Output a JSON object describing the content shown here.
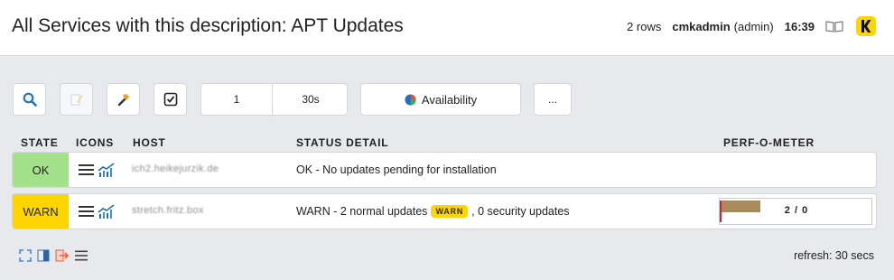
{
  "header": {
    "title": "All Services with this description: APT Updates",
    "rows": "2 rows",
    "user": "cmkadmin",
    "role": "(admin)",
    "time": "16:39",
    "logo_letter": "K"
  },
  "toolbar": {
    "search_icon": "magnifier-icon",
    "edit_icon": "edit-pencil-icon",
    "commands_icon": "hammer-icon",
    "checkbox_icon": "checkbox-icon",
    "refresh_count": "1",
    "refresh_interval": "30s",
    "availability_label": "Availability",
    "more_label": "..."
  },
  "table": {
    "columns": {
      "state": "STATE",
      "icons": "ICONS",
      "host": "HOST",
      "status_detail": "STATUS DETAIL",
      "perf": "PERF-O-METER"
    },
    "rows": [
      {
        "state": "OK",
        "state_color": "#a3e28b",
        "host": "ich2.heikejurzik.de",
        "detail": "OK - No updates pending for installation"
      },
      {
        "state": "WARN",
        "state_color": "#ffd500",
        "host": "stretch.fritz.box",
        "detail_before": "WARN - 2 normal updates",
        "detail_badge": "WARN",
        "detail_after": ", 0 security updates",
        "perf_value": "2 / 0",
        "perf_fill_fraction": 0.27
      }
    ]
  },
  "footer": {
    "refresh": "refresh: 30 secs"
  }
}
